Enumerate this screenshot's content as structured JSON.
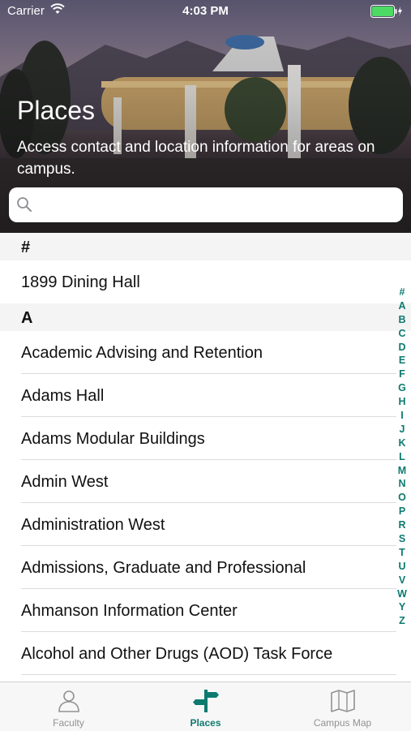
{
  "status": {
    "carrier": "Carrier",
    "time": "4:03 PM"
  },
  "header": {
    "title": "Places",
    "subtitle": "Access contact and location information for areas on campus."
  },
  "search": {
    "placeholder": ""
  },
  "sections": [
    {
      "header": "#",
      "items": [
        "1899 Dining Hall"
      ]
    },
    {
      "header": "A",
      "items": [
        "Academic Advising and Retention",
        "Adams Hall",
        "Adams Modular Buildings",
        "Admin West",
        "Administration West",
        "Admissions, Graduate and Professional",
        "Ahmanson Information Center",
        "Alcohol and Other Drugs (AOD) Task Force"
      ]
    }
  ],
  "index_letters": [
    "#",
    "A",
    "B",
    "C",
    "D",
    "E",
    "F",
    "G",
    "H",
    "I",
    "J",
    "K",
    "L",
    "M",
    "N",
    "O",
    "P",
    "R",
    "S",
    "T",
    "U",
    "V",
    "W",
    "Y",
    "Z"
  ],
  "tabs": [
    {
      "label": "Faculty",
      "icon": "person-icon",
      "active": false
    },
    {
      "label": "Places",
      "icon": "signpost-icon",
      "active": true
    },
    {
      "label": "Campus Map",
      "icon": "map-icon",
      "active": false
    }
  ],
  "colors": {
    "accent": "#0d7a6f",
    "inactive": "#929292"
  }
}
